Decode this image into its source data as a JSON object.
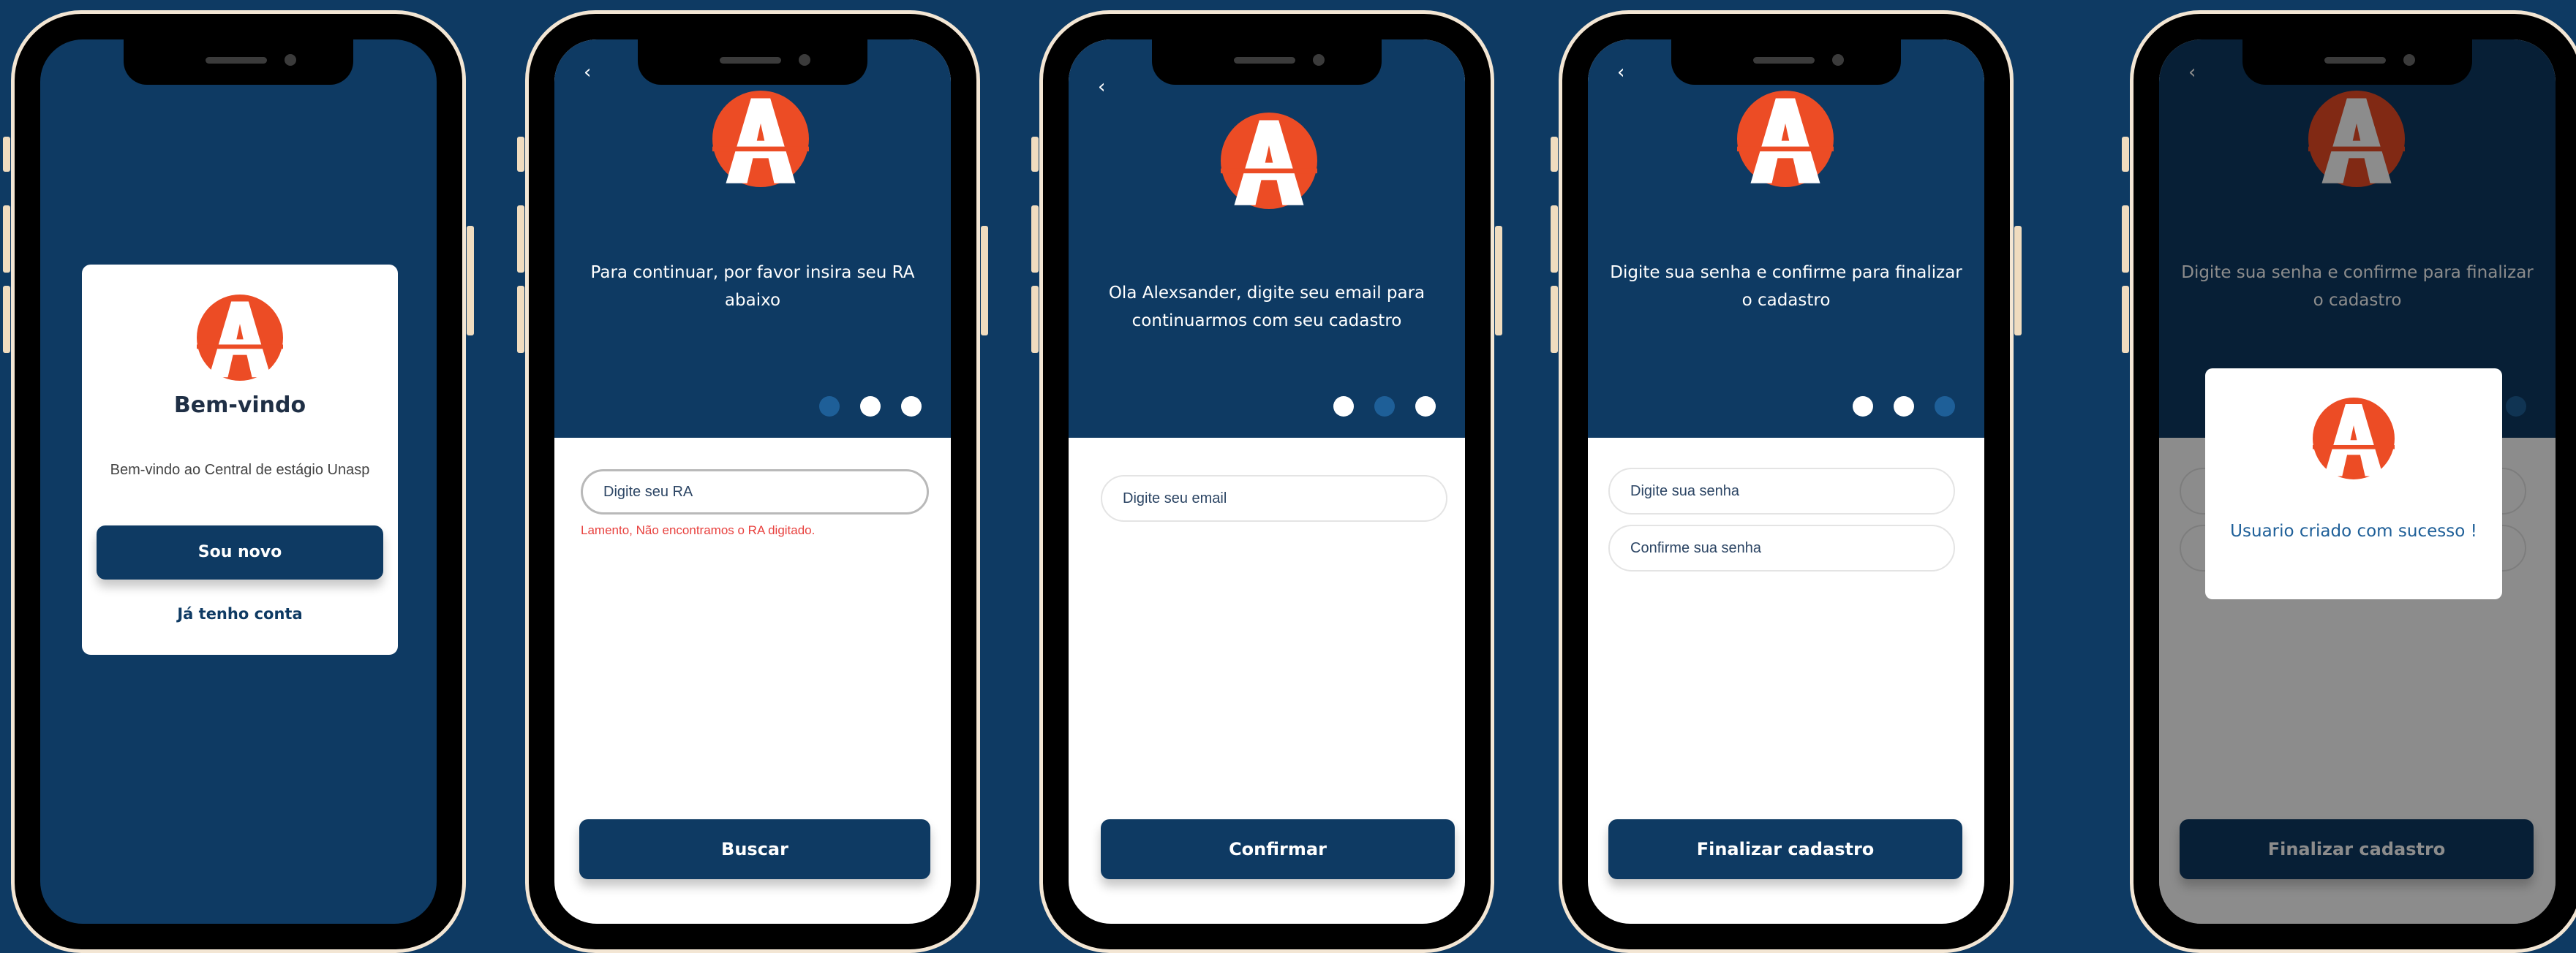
{
  "screens": {
    "welcome": {
      "title": "Bem-vindo",
      "subtitle": "Bem-vindo ao Central de estágio Unasp",
      "primary_button": "Sou novo",
      "secondary_link": "Já tenho conta"
    },
    "ra": {
      "back": "‹",
      "prompt": "Para continuar, por favor insira seu RA abaixo",
      "input_placeholder": "Digite seu RA",
      "error": "Lamento, Não encontramos o RA digitado.",
      "button": "Buscar",
      "step": 1
    },
    "email": {
      "back": "‹",
      "prompt": "Ola Alexsander, digite seu email para continuarmos com seu cadastro",
      "input_placeholder": "Digite seu email",
      "button": "Confirmar",
      "step": 2
    },
    "password": {
      "back": "‹",
      "prompt": "Digite sua senha e confirme para finalizar o cadastro",
      "password_placeholder": "Digite sua senha",
      "confirm_placeholder": "Confirme sua senha",
      "button": "Finalizar cadastro",
      "step": 3
    },
    "success": {
      "back": "‹",
      "prompt": "Digite sua senha e confirme para finalizar o cadastro",
      "modal_message": "Usuario criado com sucesso !",
      "button": "Finalizar cadastro"
    }
  },
  "icons": {
    "logo": "unasp-a-logo-icon",
    "back": "chevron-left-icon"
  },
  "colors": {
    "background": "#0e3a63",
    "primary": "#0e3a63",
    "accent": "#ec4c25",
    "error": "#e8413e",
    "dot_active": "#1e5f98"
  }
}
